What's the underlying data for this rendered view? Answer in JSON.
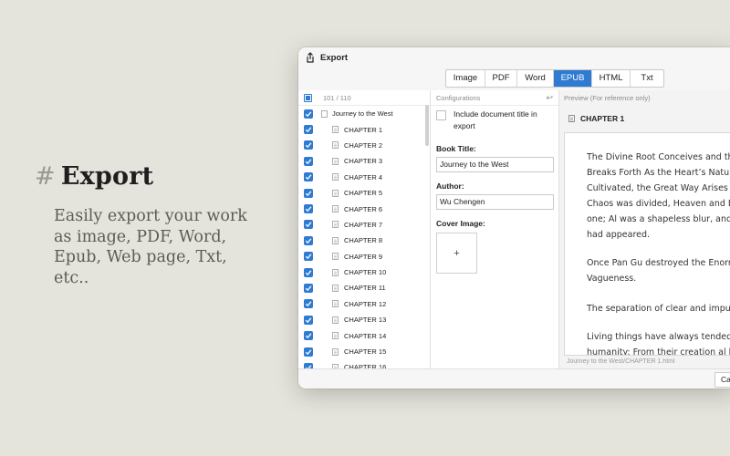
{
  "hero": {
    "hash": "#",
    "title": "Export",
    "description": "Easily export your work as image, PDF, Word, Epub, Web page, Txt, etc.."
  },
  "window": {
    "title": "Export",
    "tabs": [
      {
        "label": "Image",
        "active": false
      },
      {
        "label": "PDF",
        "active": false
      },
      {
        "label": "Word",
        "active": false
      },
      {
        "label": "EPUB",
        "active": true
      },
      {
        "label": "HTML",
        "active": false
      },
      {
        "label": "Txt",
        "active": false
      }
    ]
  },
  "tree": {
    "count": "101 / 110",
    "book": "Journey to the West",
    "chapters": [
      "CHAPTER 1",
      "CHAPTER 2",
      "CHAPTER 3",
      "CHAPTER 4",
      "CHAPTER 5",
      "CHAPTER 6",
      "CHAPTER 7",
      "CHAPTER 8",
      "CHAPTER 9",
      "CHAPTER 10",
      "CHAPTER 11",
      "CHAPTER 12",
      "CHAPTER 13",
      "CHAPTER 14",
      "CHAPTER 15",
      "CHAPTER 16"
    ]
  },
  "config": {
    "header": "Configurations",
    "include_title_label": "Include document title in export",
    "book_title_label": "Book Title:",
    "book_title_value": "Journey to the West",
    "author_label": "Author:",
    "author_value": "Wu Chengen",
    "cover_label": "Cover Image:",
    "cover_add": "+"
  },
  "preview": {
    "header": "Preview (For reference only)",
    "chapter_title": "CHAPTER 1",
    "paragraphs": [
      "The Divine Root Conceives and th",
      "Breaks Forth As the Heart’s Natur",
      "Cultivated, the Great Way Arises E",
      "Chaos was divided, Heaven and E",
      "one; Al was a shapeless blur, and",
      "had appeared.",
      "Once Pan Gu destroyed the Enorm",
      "Vagueness.",
      "The separation of clear and impur",
      "Living things have always tended",
      "humanity: From their creation al b"
    ],
    "footer": "Journey to the West/CHAPTER 1.html"
  },
  "footer": {
    "cancel_label": "Ca"
  },
  "colors": {
    "accent": "#2f7bd1",
    "background": "#e5e4dc"
  }
}
